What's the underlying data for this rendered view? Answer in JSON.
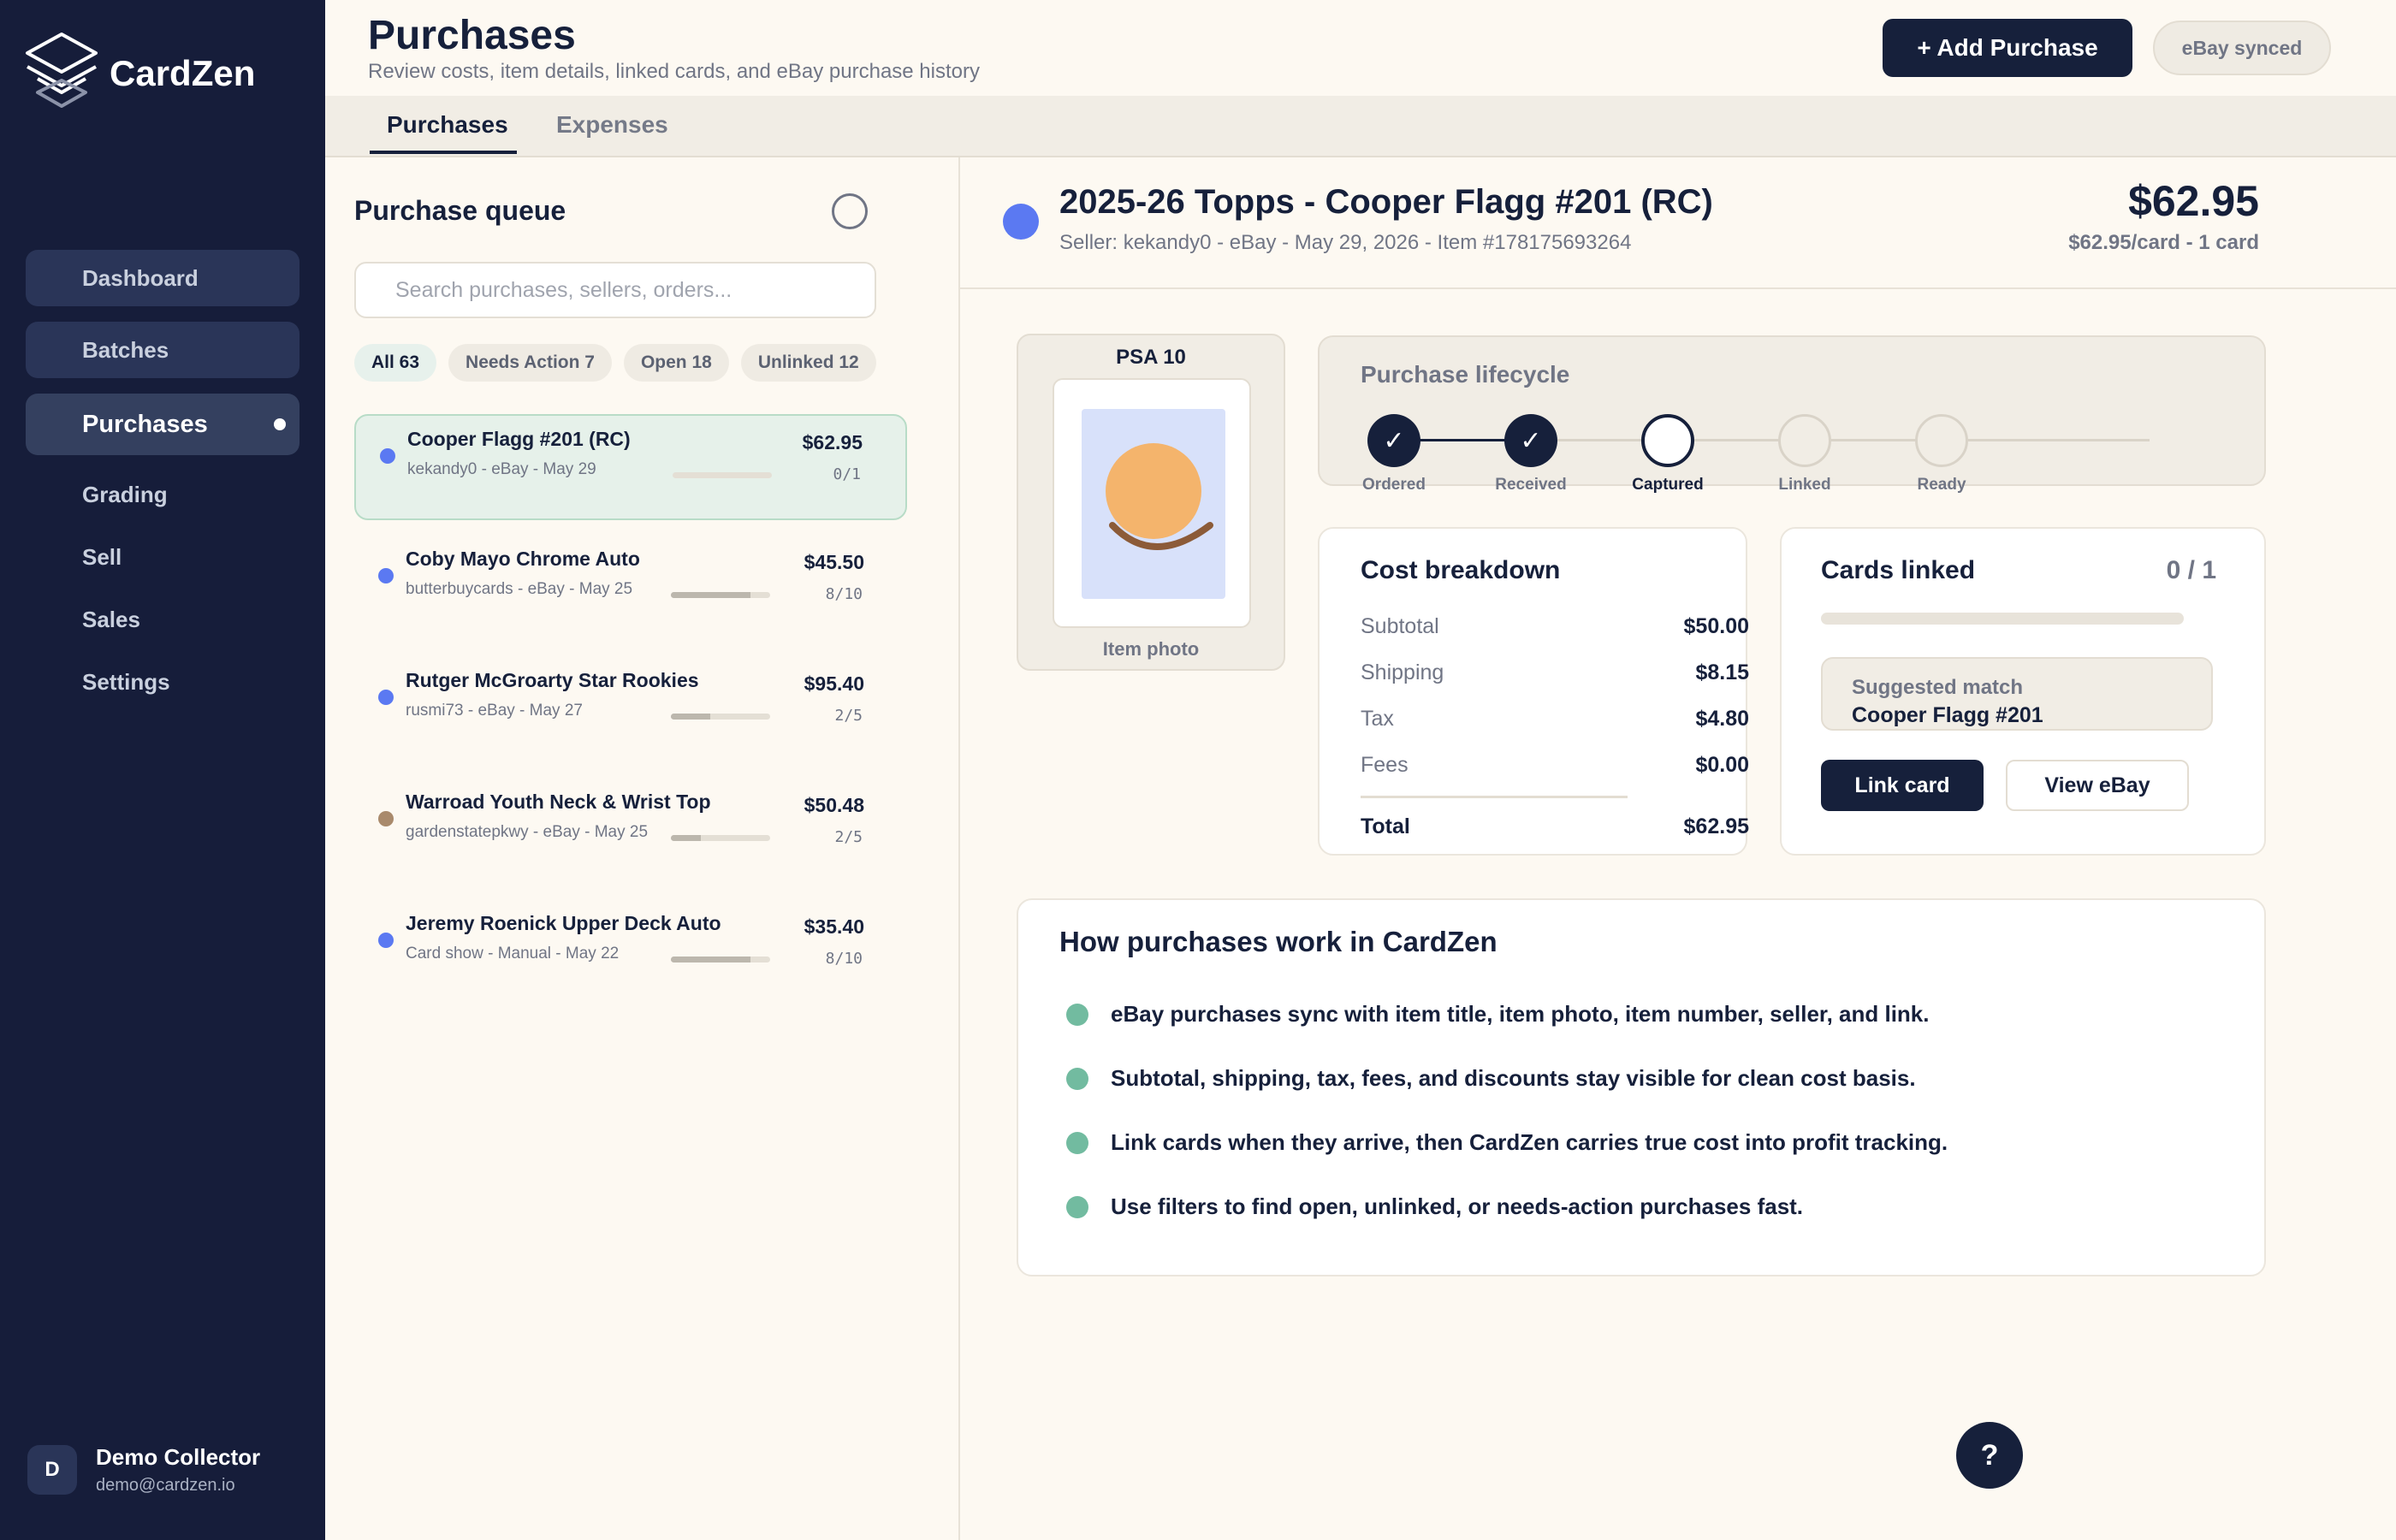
{
  "app": {
    "name": "CardZen"
  },
  "sidebar": {
    "items": [
      {
        "label": "Dashboard"
      },
      {
        "label": "Batches"
      },
      {
        "label": "Purchases"
      },
      {
        "label": "Grading"
      },
      {
        "label": "Sell"
      },
      {
        "label": "Sales"
      },
      {
        "label": "Settings"
      }
    ],
    "user": {
      "initial": "D",
      "name": "Demo Collector",
      "email": "demo@cardzen.io"
    }
  },
  "header": {
    "title": "Purchases",
    "subtitle": "Review costs, item details, linked cards, and eBay purchase history",
    "add_button": "+ Add Purchase",
    "sync_status": "eBay synced"
  },
  "tabs": [
    {
      "label": "Purchases"
    },
    {
      "label": "Expenses"
    }
  ],
  "queue": {
    "title": "Purchase queue",
    "search_placeholder": "Search purchases, sellers, orders...",
    "filters": [
      {
        "label": "All 63"
      },
      {
        "label": "Needs Action 7"
      },
      {
        "label": "Open 18"
      },
      {
        "label": "Unlinked 12"
      }
    ],
    "items": [
      {
        "title": "Cooper Flagg #201 (RC)",
        "meta": "kekandy0 - eBay - May 29",
        "price": "$62.95",
        "count": "0/1",
        "progress": 0,
        "dot_color": "#5b79f2"
      },
      {
        "title": "Coby Mayo Chrome Auto",
        "meta": "butterbuycards - eBay - May 25",
        "price": "$45.50",
        "count": "8/10",
        "progress": 0.8,
        "dot_color": "#5b79f2"
      },
      {
        "title": "Rutger McGroarty Star Rookies",
        "meta": "rusmi73 - eBay - May 27",
        "price": "$95.40",
        "count": "2/5",
        "progress": 0.4,
        "dot_color": "#5b79f2"
      },
      {
        "title": "Warroad Youth Neck & Wrist Top",
        "meta": "gardenstatepkwy - eBay - May 25",
        "price": "$50.48",
        "count": "2/5",
        "progress": 0.3,
        "dot_color": "#a98a6c"
      },
      {
        "title": "Jeremy Roenick Upper Deck Auto",
        "meta": "Card show - Manual - May 22",
        "price": "$35.40",
        "count": "8/10",
        "progress": 0.8,
        "dot_color": "#5b79f2"
      }
    ]
  },
  "detail": {
    "title": "2025-26 Topps - Cooper Flagg #201 (RC)",
    "meta": "Seller: kekandy0 - eBay - May 29, 2026 - Item #178175693264",
    "price": "$62.95",
    "per_card": "$62.95/card - 1 card",
    "photo": {
      "grade": "PSA 10",
      "caption": "Item photo"
    },
    "lifecycle": {
      "title": "Purchase lifecycle",
      "steps": [
        {
          "label": "Ordered",
          "state": "done"
        },
        {
          "label": "Received",
          "state": "done"
        },
        {
          "label": "Captured",
          "state": "current"
        },
        {
          "label": "Linked",
          "state": "todo"
        },
        {
          "label": "Ready",
          "state": "todo"
        }
      ],
      "check_glyph": "✓"
    },
    "cost": {
      "title": "Cost breakdown",
      "rows": [
        {
          "label": "Subtotal",
          "value": "$50.00"
        },
        {
          "label": "Shipping",
          "value": "$8.15"
        },
        {
          "label": "Tax",
          "value": "$4.80"
        },
        {
          "label": "Fees",
          "value": "$0.00"
        }
      ],
      "total_label": "Total",
      "total_value": "$62.95"
    },
    "linked": {
      "title": "Cards linked",
      "count": "0 / 1",
      "progress": 0,
      "suggest_label": "Suggested match",
      "suggest_value": "Cooper Flagg #201",
      "link_button": "Link card",
      "ebay_button": "View eBay"
    },
    "how": {
      "title": "How purchases work in CardZen",
      "items": [
        "eBay purchases sync with item title, item photo, item number, seller, and link.",
        "Subtotal, shipping, tax, fees, and discounts stay visible for clean cost basis.",
        "Link cards when they arrive, then CardZen carries true cost into profit tracking.",
        "Use filters to find open, unlinked, or needs-action purchases fast."
      ]
    }
  },
  "help_button": "?"
}
